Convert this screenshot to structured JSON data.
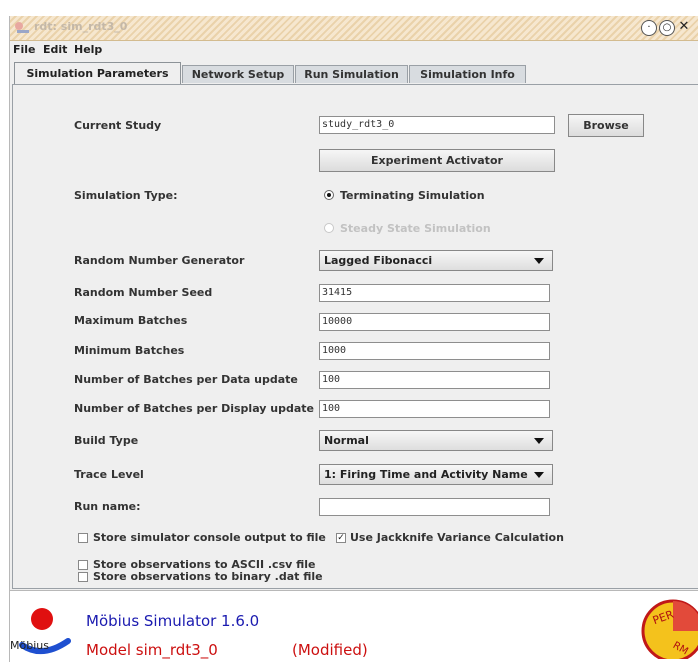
{
  "window": {
    "title": "rdt: sim_rdt3_0",
    "title_icon": "mobius-app-icon"
  },
  "menu": [
    "File",
    "Edit",
    "Help"
  ],
  "tabs": [
    {
      "label": "Simulation Parameters",
      "active": true
    },
    {
      "label": "Network Setup",
      "active": false
    },
    {
      "label": "Run Simulation",
      "active": false
    },
    {
      "label": "Simulation Info",
      "active": false
    }
  ],
  "form": {
    "current_study": {
      "label": "Current Study",
      "value": "study_rdt3_0",
      "browse": "Browse"
    },
    "experiment_activator": "Experiment Activator",
    "simulation_type": {
      "label": "Simulation Type:",
      "options": [
        {
          "label": "Terminating Simulation",
          "selected": true,
          "enabled": true
        },
        {
          "label": "Steady State Simulation",
          "selected": false,
          "enabled": false
        }
      ]
    },
    "rng": {
      "label": "Random Number Generator",
      "value": "Lagged Fibonacci"
    },
    "seed": {
      "label": "Random Number Seed",
      "value": "31415"
    },
    "max_batches": {
      "label": "Maximum Batches",
      "value": "10000"
    },
    "min_batches": {
      "label": "Minimum Batches",
      "value": "1000"
    },
    "batches_data": {
      "label": "Number of Batches per Data update",
      "value": "100"
    },
    "batches_display": {
      "label": "Number of Batches per Display update",
      "value": "100"
    },
    "build_type": {
      "label": "Build Type",
      "value": "Normal"
    },
    "trace_level": {
      "label": "Trace Level",
      "value": "1: Firing Time and Activity Name"
    },
    "run_name": {
      "label": "Run name:",
      "value": ""
    },
    "checks": [
      {
        "label": "Store simulator console output to file",
        "checked": false
      },
      {
        "label": "Use Jackknife Variance Calculation",
        "checked": true
      },
      {
        "label": "Store observations to ASCII .csv file",
        "checked": false
      },
      {
        "label": "Store observations to binary .dat file",
        "checked": false
      }
    ]
  },
  "footer": {
    "version": "Möbius Simulator 1.6.0",
    "model": "Model sim_rdt3_0",
    "status": "(Modified)",
    "logo_text": "Möbius",
    "perform_logo": "PERFORM"
  },
  "colors": {
    "version_text": "#1b1bb0",
    "model_text": "#cc1010",
    "titlebar": "#f6e7cf"
  }
}
